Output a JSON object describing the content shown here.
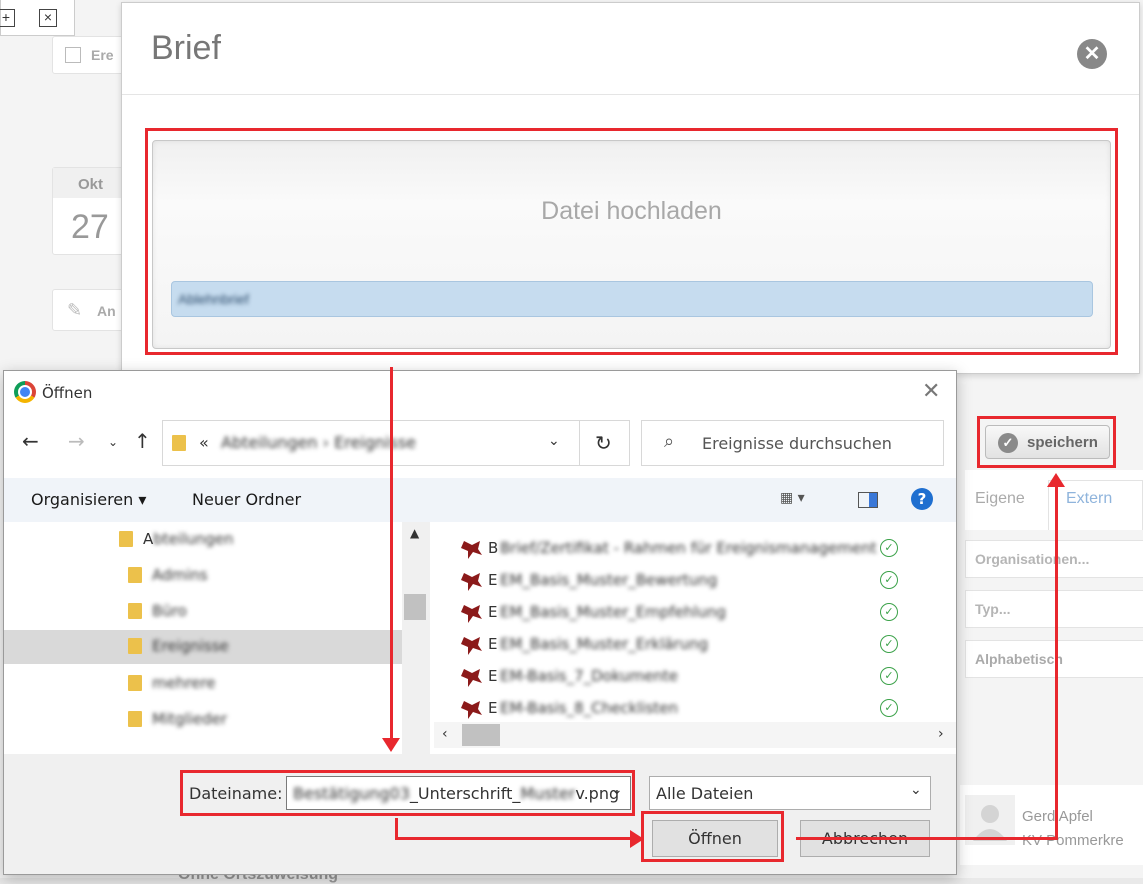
{
  "background": {
    "mini_toolbar": {
      "icons": [
        "expand-icon",
        "collapse-icon"
      ]
    },
    "event_button_label": "Ere",
    "date": {
      "month": "Okt",
      "day": "27"
    },
    "edit_button_label": "An",
    "tabs": {
      "own": "Eigene",
      "external": "Extern"
    },
    "filters": [
      "Organisationen...",
      "Typ...",
      "Alphabetisch"
    ],
    "person": {
      "name": "Gerd Apfel",
      "subtitle": "KV Pommerkre"
    },
    "bottom_text": "Ohne Ortszuweisung"
  },
  "brief_modal": {
    "title": "Brief",
    "upload_label": "Datei hochladen",
    "upload_field_value": "Ablehnbrief",
    "save_label": "speichern",
    "colors": {
      "highlight": "#e8282e",
      "upload_field": "#c6dcef"
    }
  },
  "open_dialog": {
    "title": "Öffnen",
    "address": {
      "prefix": "«",
      "path_1": "Abteilungen",
      "path_2": "Ereignisse"
    },
    "search_placeholder": "Ereignisse durchsuchen",
    "commands": {
      "organize": "Organisieren",
      "new_folder": "Neuer Ordner"
    },
    "tree": [
      {
        "label": "Abteilungen",
        "selected": false
      },
      {
        "label": "Admins",
        "selected": false
      },
      {
        "label": "Büro",
        "selected": false
      },
      {
        "label": "Ereignisse",
        "selected": true
      },
      {
        "label": "mehrere",
        "selected": false
      },
      {
        "label": "Mitglieder",
        "selected": false
      }
    ],
    "files": [
      {
        "prefix": "B",
        "rest": "Brief/Zertifikat - Rahmen für Ereignismanagement"
      },
      {
        "prefix": "E",
        "rest": "EM_Basis_Muster_Bewertung"
      },
      {
        "prefix": "E",
        "rest": "EM_Basis_Muster_Empfehlung"
      },
      {
        "prefix": "E",
        "rest": "EM_Basis_Muster_Erklärung"
      },
      {
        "prefix": "E",
        "rest": "EM-Basis_7_Dokumente"
      },
      {
        "prefix": "E",
        "rest": "EM-Basis_8_Checklisten"
      }
    ],
    "filename_label": "Dateiname:",
    "filename_blur_1": "Bestätigung",
    "filename_blur_2": "03",
    "filename_clear_1": "_Unterschrift_",
    "filename_blur_3": "Muster",
    "filename_clear_2": "v.png",
    "filter_value": "Alle Dateien",
    "open_label": "Öffnen",
    "cancel_label": "Abbrechen"
  }
}
